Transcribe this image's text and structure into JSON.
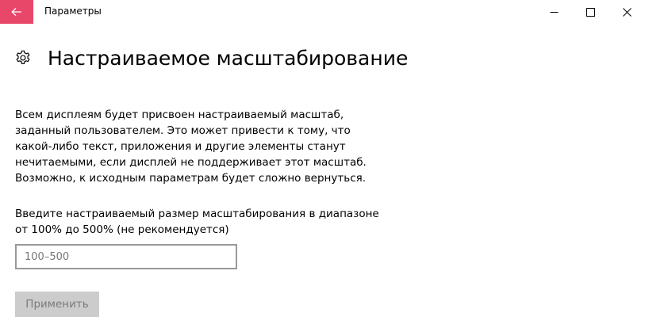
{
  "window": {
    "title": "Параметры",
    "accent_color": "#e8476a"
  },
  "header": {
    "icon": "gear-icon",
    "title": "Настраиваемое масштабирование"
  },
  "description": {
    "lines": [
      "Всем дисплеям будет присвоен настраиваемый масштаб,",
      "заданный пользователем. Это может привести к тому, что",
      "какой-либо текст, приложения и другие элементы станут",
      "нечитаемыми, если дисплей не поддерживает этот масштаб.",
      "Возможно, к исходным параметрам будет сложно вернуться."
    ]
  },
  "prompt": {
    "lines": [
      "Введите настраиваемый размер масштабирования в диапазоне",
      "от 100%  до 500%  (не рекомендуется)"
    ]
  },
  "scale_input": {
    "value": "",
    "placeholder": "100–500"
  },
  "apply_button": {
    "label": "Применить",
    "enabled": false
  }
}
